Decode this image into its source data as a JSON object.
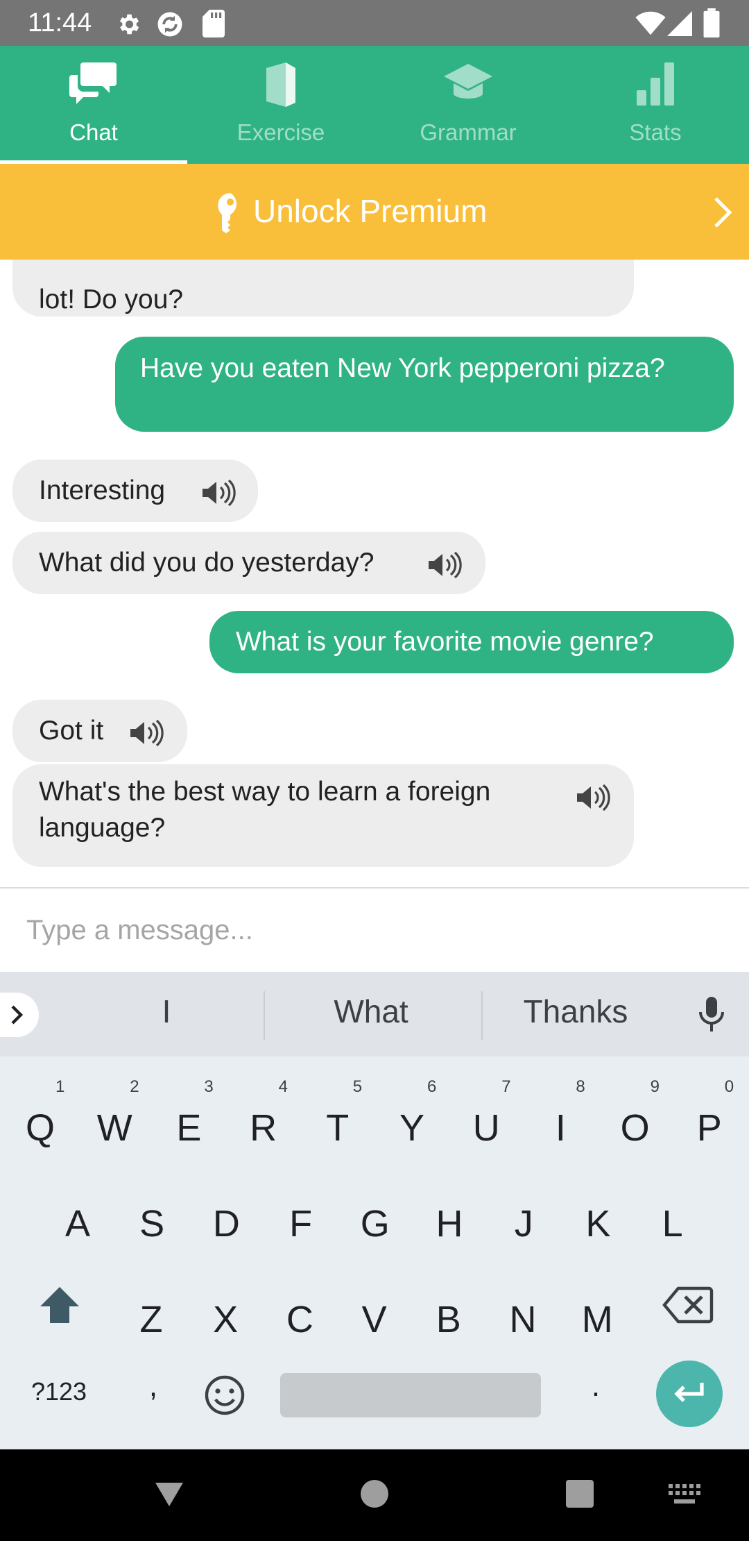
{
  "status_bar": {
    "time": "11:44",
    "icons": [
      "gear-icon",
      "sync-icon",
      "sd-card-icon",
      "wifi-icon",
      "signal-icon",
      "battery-icon"
    ]
  },
  "tabs": [
    {
      "label": "Chat",
      "icon": "chat-icon",
      "active": true
    },
    {
      "label": "Exercise",
      "icon": "book-icon",
      "active": false
    },
    {
      "label": "Grammar",
      "icon": "graduation-cap-icon",
      "active": false
    },
    {
      "label": "Stats",
      "icon": "bar-chart-icon",
      "active": false
    }
  ],
  "premium": {
    "label": "Unlock Premium",
    "icon": "key-icon"
  },
  "messages": [
    {
      "from": "bot",
      "text": "lot! Do you?",
      "partial": true
    },
    {
      "from": "user",
      "text": "Have you eaten New York pepperoni pizza?"
    },
    {
      "from": "bot",
      "text": "Interesting"
    },
    {
      "from": "bot",
      "text": "What did you do yesterday?"
    },
    {
      "from": "user",
      "text": "What is your favorite movie genre?"
    },
    {
      "from": "bot",
      "text": "Got it"
    },
    {
      "from": "bot",
      "text": "What's the best way to learn a foreign language?"
    }
  ],
  "composer": {
    "placeholder": "Type a message...",
    "value": ""
  },
  "keyboard": {
    "suggestions": [
      "I",
      "What",
      "Thanks"
    ],
    "row1": [
      "Q",
      "W",
      "E",
      "R",
      "T",
      "Y",
      "U",
      "I",
      "O",
      "P"
    ],
    "row1_hints": [
      "1",
      "2",
      "3",
      "4",
      "5",
      "6",
      "7",
      "8",
      "9",
      "0"
    ],
    "row2": [
      "A",
      "S",
      "D",
      "F",
      "G",
      "H",
      "J",
      "K",
      "L"
    ],
    "row3": [
      "Z",
      "X",
      "C",
      "V",
      "B",
      "N",
      "M"
    ],
    "symbols_key": "?123",
    "comma_key": ",",
    "period_key": "."
  },
  "colors": {
    "brand_green": "#2fb385",
    "premium_yellow": "#f9bf3b",
    "status_bar": "#757575",
    "enter_teal": "#4db6ac"
  }
}
